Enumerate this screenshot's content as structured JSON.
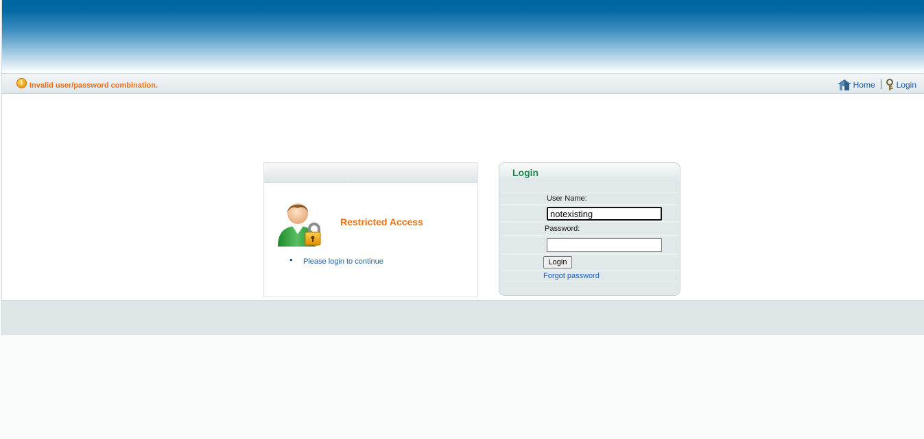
{
  "status": {
    "alert_icon": "warning-icon",
    "message": "Invalid user/password combination."
  },
  "nav": {
    "home_label": "Home",
    "home_icon": "house-icon",
    "login_label": "Login",
    "login_icon": "key-icon"
  },
  "restricted": {
    "title": "Restricted Access",
    "icon": "user-lock-icon",
    "items": [
      "Please login to continue"
    ]
  },
  "login_form": {
    "title": "Login",
    "username_label": "User Name:",
    "username_value": "notexisting",
    "password_label": "Password:",
    "password_value": "",
    "submit_label": "Login",
    "forgot_label": "Forgot password"
  },
  "colors": {
    "header_blue": "#0066a1",
    "alert_orange": "#ef6e14",
    "link_blue": "#1a5aa8",
    "login_title_green": "#1f8a4d"
  }
}
